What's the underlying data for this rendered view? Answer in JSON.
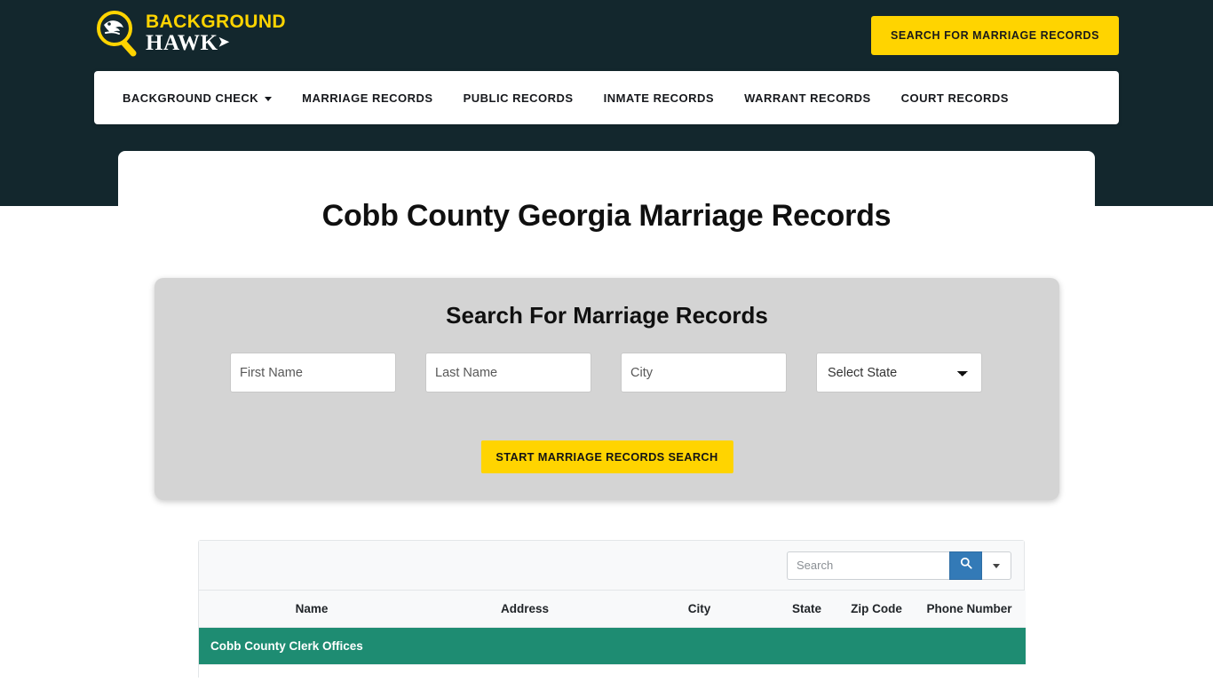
{
  "brand": {
    "logo_line1": "BACKGROUND",
    "logo_line2": "HAWK",
    "logo_icon": "magnifier-hawk-logo"
  },
  "header": {
    "cta_label": "SEARCH FOR MARRIAGE RECORDS",
    "background_color": "#13272D",
    "accent_color": "#FFD400"
  },
  "nav": {
    "items": [
      {
        "label": "BACKGROUND CHECK",
        "has_dropdown": true
      },
      {
        "label": "MARRIAGE RECORDS",
        "has_dropdown": false
      },
      {
        "label": "PUBLIC RECORDS",
        "has_dropdown": false
      },
      {
        "label": "INMATE RECORDS",
        "has_dropdown": false
      },
      {
        "label": "WARRANT RECORDS",
        "has_dropdown": false
      },
      {
        "label": "COURT RECORDS",
        "has_dropdown": false
      }
    ]
  },
  "main": {
    "page_title": "Cobb County Georgia Marriage Records",
    "search_form": {
      "heading": "Search For Marriage Records",
      "first_name_placeholder": "First Name",
      "first_name_value": "",
      "last_name_placeholder": "Last Name",
      "last_name_value": "",
      "city_placeholder": "City",
      "city_value": "",
      "state_selected": "Select State",
      "state_options": [
        "Select State"
      ],
      "submit_label": "START MARRIAGE RECORDS SEARCH",
      "panel_color": "#D4D4D4"
    },
    "records_table": {
      "search_placeholder": "Search",
      "search_value": "",
      "search_button_icon": "search-icon",
      "search_dropdown_icon": "chevron-down-icon",
      "search_button_color": "#337AB7",
      "columns": [
        "Name",
        "Address",
        "City",
        "State",
        "Zip Code",
        "Phone Number"
      ],
      "group_rows": [
        {
          "label": "Cobb County Clerk Offices",
          "color": "#1E8C72"
        }
      ]
    }
  }
}
